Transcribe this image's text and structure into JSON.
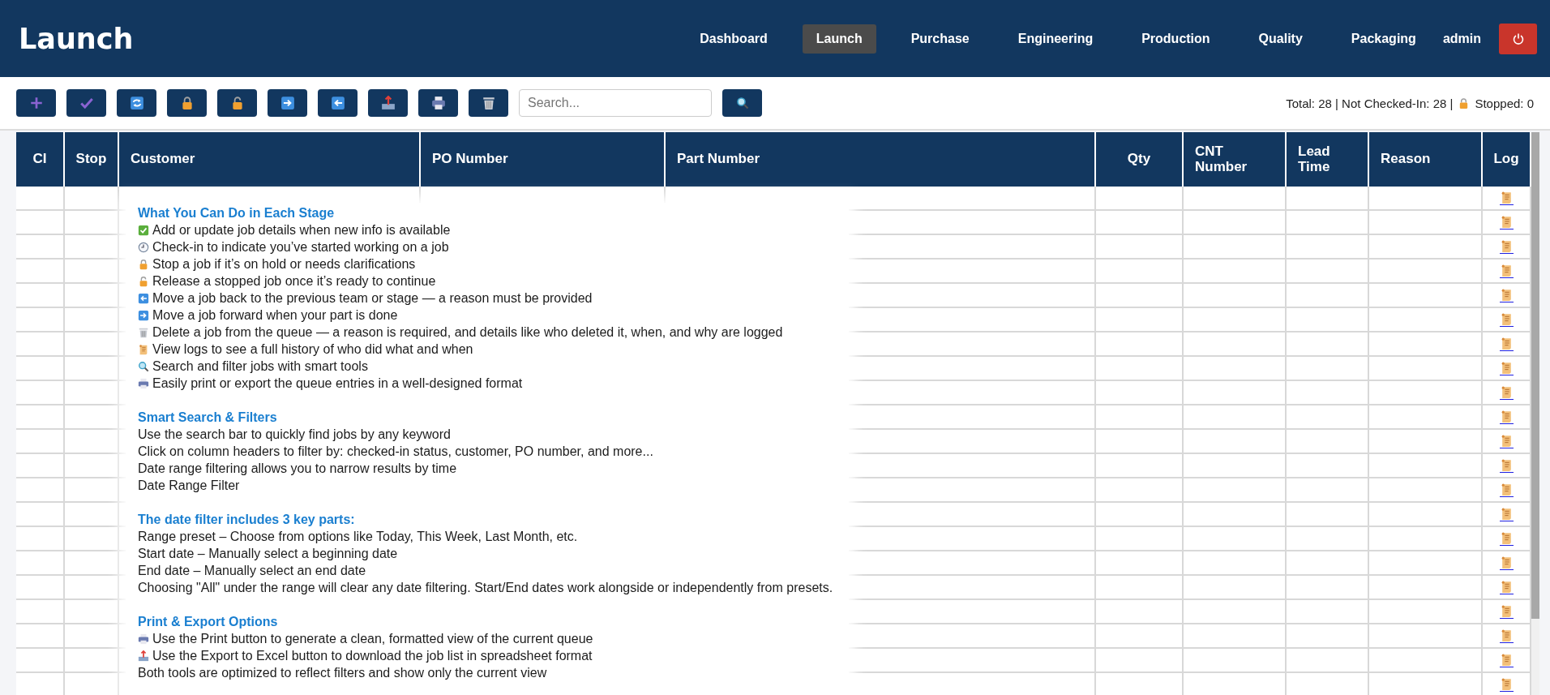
{
  "header": {
    "title": "Launch",
    "nav": [
      {
        "label": "Dashboard",
        "selected": false
      },
      {
        "label": "Launch",
        "selected": true
      },
      {
        "label": "Purchase",
        "selected": false
      },
      {
        "label": "Engineering",
        "selected": false
      },
      {
        "label": "Production",
        "selected": false
      },
      {
        "label": "Quality",
        "selected": false
      },
      {
        "label": "Packaging",
        "selected": false
      }
    ],
    "user": "admin"
  },
  "toolbar": {
    "buttons": [
      {
        "kind": "plus"
      },
      {
        "kind": "check"
      },
      {
        "kind": "refresh"
      },
      {
        "kind": "lock"
      },
      {
        "kind": "unlock"
      },
      {
        "kind": "arrow-right"
      },
      {
        "kind": "arrow-left"
      },
      {
        "kind": "export"
      },
      {
        "kind": "printer"
      },
      {
        "kind": "trash"
      }
    ],
    "search": {
      "placeholder": "Search..."
    },
    "stats": "Total: 28 | Not Checked-In: 28 |",
    "stopped": "Stopped: 0"
  },
  "table": {
    "columns": [
      "CI",
      "Stop",
      "Customer",
      "PO Number",
      "Part Number",
      "Qty",
      "CNT Number",
      "Lead Time",
      "Reason",
      "Log"
    ],
    "rows": [
      {
        "kind": "job"
      },
      {
        "kind": "job"
      },
      {
        "kind": "job"
      },
      {
        "kind": "job"
      },
      {
        "kind": "job"
      },
      {
        "kind": "job"
      },
      {
        "kind": "job"
      },
      {
        "kind": "job"
      },
      {
        "kind": "job"
      },
      {
        "kind": "job"
      },
      {
        "kind": "job"
      },
      {
        "kind": "job"
      },
      {
        "kind": "job"
      },
      {
        "kind": "job"
      },
      {
        "kind": "job"
      },
      {
        "kind": "job"
      },
      {
        "kind": "job"
      },
      {
        "kind": "job"
      },
      {
        "kind": "job"
      },
      {
        "kind": "job"
      },
      {
        "kind": "job"
      }
    ]
  },
  "help": [
    {
      "title": "What You Can Do in Each Stage",
      "lines": [
        {
          "kind": "check-box",
          "text": "Add or update job details when new info is available"
        },
        {
          "kind": "clock",
          "text": "Check-in to indicate you’ve started working on a job"
        },
        {
          "kind": "lock",
          "text": "Stop a job if it’s on hold or needs clarifications"
        },
        {
          "kind": "unlock",
          "text": "Release a stopped job once it’s ready to continue"
        },
        {
          "kind": "arrow-left",
          "text": "Move a job back to the previous team or stage — a reason must be provided"
        },
        {
          "kind": "arrow-right",
          "text": "Move a job forward when your part is done"
        },
        {
          "kind": "trash",
          "text": "Delete a job from the queue — a reason is required, and details like who deleted it, when, and why are logged"
        },
        {
          "kind": "scroll",
          "text": "View logs to see a full history of who did what and when"
        },
        {
          "kind": "search",
          "text": "Search and filter jobs with smart tools"
        },
        {
          "kind": "printer",
          "text": "Easily print or export the queue entries in a well-designed format"
        }
      ]
    },
    {
      "title": "Smart Search & Filters",
      "lines": [
        {
          "kind": "plain",
          "text": "Use the search bar to quickly find jobs by any keyword"
        },
        {
          "kind": "plain",
          "text": "Click on column headers to filter by: checked-in status, customer, PO number, and more..."
        },
        {
          "kind": "plain",
          "text": "Date range filtering allows you to narrow results by time"
        },
        {
          "kind": "plain",
          "text": "Date Range Filter"
        }
      ]
    },
    {
      "title": "The date filter includes 3 key parts:",
      "lines": [
        {
          "kind": "plain",
          "text": "Range preset – Choose from options like Today, This Week, Last Month, etc."
        },
        {
          "kind": "plain",
          "text": "Start date – Manually select a beginning date"
        },
        {
          "kind": "plain",
          "text": "End date – Manually select an end date"
        },
        {
          "kind": "plain",
          "text": "Choosing \"All\" under the range will clear any date filtering. Start/End dates work alongside or independently from presets."
        }
      ]
    },
    {
      "title": "Print & Export Options",
      "lines": [
        {
          "kind": "printer",
          "text": "Use the Print button to generate a clean, formatted view of the current queue"
        },
        {
          "kind": "export",
          "text": "Use the Export to Excel button to download the job list in spreadsheet format"
        },
        {
          "kind": "plain",
          "text": "Both tools are optimized to reflect filters and show only the current view"
        }
      ]
    }
  ]
}
